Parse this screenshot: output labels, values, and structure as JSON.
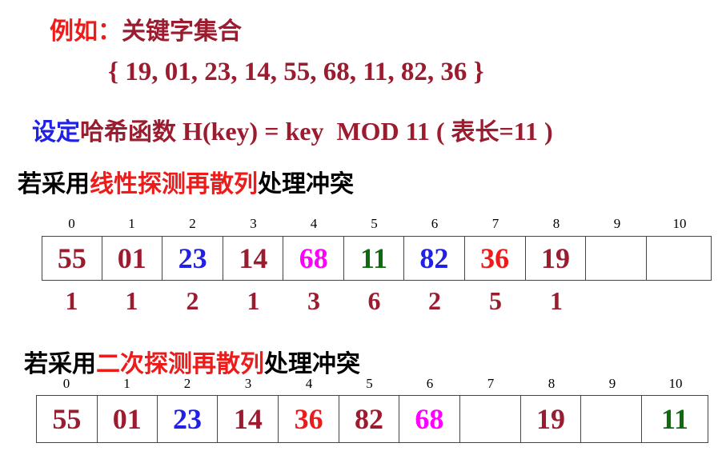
{
  "colors": {
    "dark_red": "#9b1b2f",
    "red": "#ee1b1b",
    "blue": "#2020e6",
    "black": "#000000",
    "magenta": "#ff00ff",
    "green": "#0d6b0d"
  },
  "example": {
    "prefix": "例如：",
    "title": "关键字集合",
    "keys": "{ 19, 01, 23, 14, 55, 68, 11, 82, 36 }"
  },
  "hash": {
    "lead": "设定",
    "label": "哈希函数",
    "formula": " H(key) = key  MOD 11 ( ",
    "table_len_label": "表长",
    "table_len_value": "=11 )"
  },
  "linear": {
    "heading_prefix": "若采用",
    "heading_method": "线性探测再散列",
    "heading_suffix": "处理冲突",
    "indices": [
      "0",
      "1",
      "2",
      "3",
      "4",
      "5",
      "6",
      "7",
      "8",
      "9",
      "10"
    ],
    "cells": [
      {
        "value": "55",
        "color": "#9b1b2f"
      },
      {
        "value": "01",
        "color": "#9b1b2f"
      },
      {
        "value": "23",
        "color": "#2020e6"
      },
      {
        "value": "14",
        "color": "#9b1b2f"
      },
      {
        "value": "68",
        "color": "#ff00ff"
      },
      {
        "value": "11",
        "color": "#0d6b0d"
      },
      {
        "value": "82",
        "color": "#2020e6"
      },
      {
        "value": "36",
        "color": "#ee1b1b"
      },
      {
        "value": "19",
        "color": "#9b1b2f"
      },
      {
        "value": "",
        "color": "#9b1b2f"
      },
      {
        "value": "",
        "color": "#9b1b2f"
      }
    ],
    "probe_counts": [
      "1",
      "1",
      "2",
      "1",
      "3",
      "6",
      "2",
      "5",
      "1"
    ]
  },
  "quadratic": {
    "heading_prefix": "若采用",
    "heading_method": "二次探测再散列",
    "heading_suffix": "处理冲突",
    "indices": [
      "0",
      "1",
      "2",
      "3",
      "4",
      "5",
      "6",
      "7",
      "8",
      "9",
      "10"
    ],
    "cells": [
      {
        "value": "55",
        "color": "#9b1b2f"
      },
      {
        "value": "01",
        "color": "#9b1b2f"
      },
      {
        "value": "23",
        "color": "#2020e6"
      },
      {
        "value": "14",
        "color": "#9b1b2f"
      },
      {
        "value": "36",
        "color": "#ee1b1b"
      },
      {
        "value": "82",
        "color": "#9b1b2f"
      },
      {
        "value": "68",
        "color": "#ff00ff"
      },
      {
        "value": "",
        "color": "#9b1b2f"
      },
      {
        "value": "19",
        "color": "#9b1b2f"
      },
      {
        "value": "",
        "color": "#9b1b2f"
      },
      {
        "value": "11",
        "color": "#0d6b0d"
      }
    ]
  }
}
